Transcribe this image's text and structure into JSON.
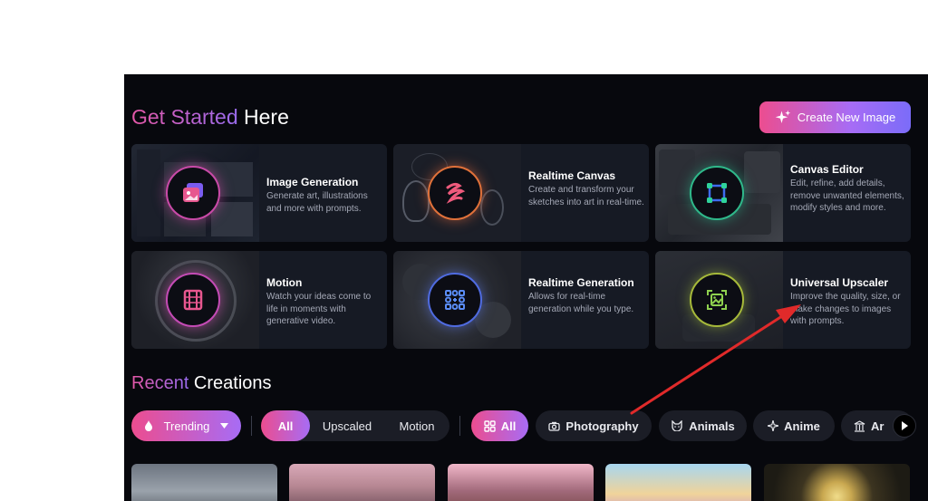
{
  "header": {
    "title_accent": "Get Started",
    "title_rest": " Here",
    "create_button_label": "Create New Image"
  },
  "cards": [
    {
      "title": "Image Generation",
      "description": "Generate art, illustrations and more with prompts.",
      "icon": "images-icon"
    },
    {
      "title": "Realtime Canvas",
      "description": "Create and transform your sketches into art in real-time.",
      "icon": "brush-stroke-icon"
    },
    {
      "title": "Canvas Editor",
      "description": "Edit, refine, add details, remove unwanted elements, modify styles and more.",
      "icon": "vector-square-icon"
    },
    {
      "title": "Motion",
      "description": "Watch your ideas come to life in moments with generative video.",
      "icon": "film-icon"
    },
    {
      "title": "Realtime Generation",
      "description": "Allows for real-time generation while you type.",
      "icon": "grid-dots-icon"
    },
    {
      "title": "Universal Upscaler",
      "description": "Improve the quality, size, or make changes to images with prompts.",
      "icon": "upscale-image-icon"
    }
  ],
  "recent": {
    "title_accent": "Recent",
    "title_rest": " Creations"
  },
  "filters": {
    "sort": "Trending",
    "type_options": [
      "All",
      "Upscaled",
      "Motion"
    ],
    "type_selected": "All",
    "categories": [
      "All",
      "Photography",
      "Animals",
      "Anime",
      "Ar"
    ],
    "category_selected": "All"
  },
  "colors": {
    "background": "#07080d",
    "card": "#161a24",
    "accent_pink": "#ec4d8f",
    "accent_purple": "#a76cf5",
    "annotation_arrow": "#e02a2a"
  }
}
